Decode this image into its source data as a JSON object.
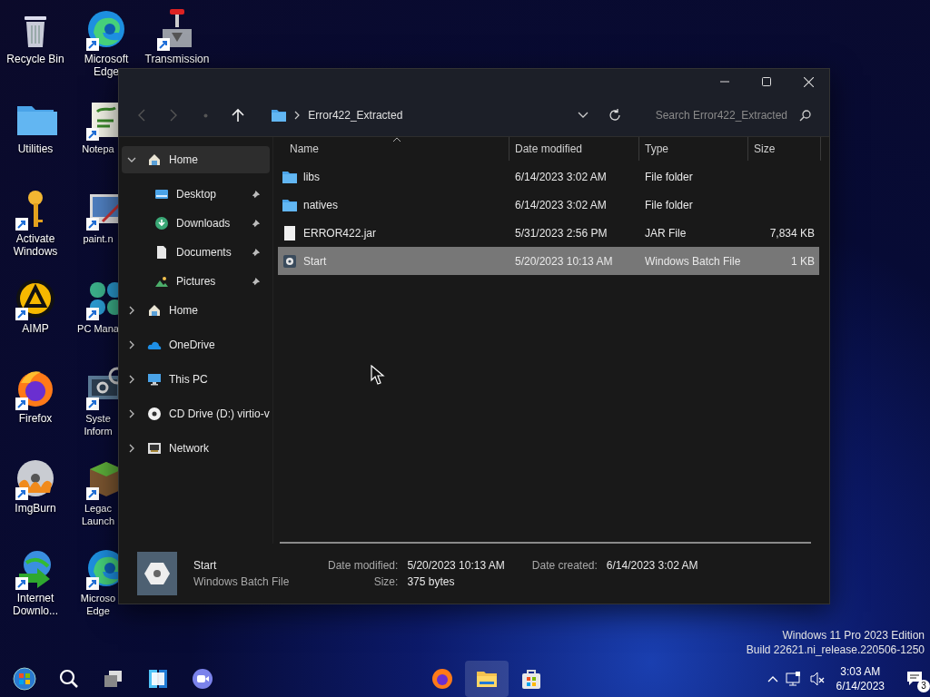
{
  "desktop_icons": [
    {
      "kind": "bin",
      "label": "Recycle Bin",
      "shortcut": false
    },
    {
      "kind": "folder",
      "label": "Utilities",
      "shortcut": false
    },
    {
      "kind": "key",
      "label": "Activate Windows",
      "shortcut": true
    },
    {
      "kind": "aimp",
      "label": "AIMP",
      "shortcut": true
    },
    {
      "kind": "firefox",
      "label": "Firefox",
      "shortcut": true
    },
    {
      "kind": "imgburn",
      "label": "ImgBurn",
      "shortcut": true
    },
    {
      "kind": "idm",
      "label": "Internet Downlo...",
      "shortcut": true
    },
    {
      "kind": "edge",
      "label": "Microsoft Edge",
      "shortcut": true
    },
    {
      "kind": "notepad",
      "label": "Notepa",
      "shortcut": true
    },
    {
      "kind": "paint",
      "label": "paint.n",
      "shortcut": true
    },
    {
      "kind": "pcmanager",
      "label": "PC Mana",
      "shortcut": true
    },
    {
      "kind": "sysinfo",
      "label": "Syste Inform",
      "shortcut": true
    },
    {
      "kind": "minecraft",
      "label": "Legac Launch",
      "shortcut": true
    },
    {
      "kind": "edge",
      "label": "Microso Edge",
      "shortcut": true
    },
    {
      "kind": "transmission",
      "label": "Transmission",
      "shortcut": true
    }
  ],
  "explorer": {
    "nav": [
      {
        "kind": "back",
        "disabled": true
      },
      {
        "kind": "forward",
        "disabled": true
      },
      {
        "kind": "recent",
        "disabled": true
      },
      {
        "kind": "up",
        "disabled": false
      }
    ],
    "path": [
      "Error422_Extracted"
    ],
    "search": {
      "placeholder": "Search Error422_Extracted"
    },
    "sidebar": {
      "items": [
        {
          "kind": "home",
          "label": "Home",
          "expanded": true,
          "selected": true,
          "children": [
            {
              "kind": "desktop",
              "label": "Desktop",
              "pinned": true,
              "selected": false
            },
            {
              "kind": "downloads",
              "label": "Downloads",
              "pinned": true,
              "selected": false
            },
            {
              "kind": "documents",
              "label": "Documents",
              "pinned": true,
              "selected": false
            },
            {
              "kind": "pictures",
              "label": "Pictures",
              "pinned": true,
              "selected": false
            }
          ]
        },
        {
          "kind": "home",
          "label": "Home",
          "expanded": false,
          "selected": false
        },
        {
          "kind": "onedrive",
          "label": "OneDrive",
          "expanded": false,
          "selected": false
        },
        {
          "kind": "pc",
          "label": "This PC",
          "expanded": false,
          "selected": false
        },
        {
          "kind": "cd",
          "label": "CD Drive (D:) virtio-v",
          "expanded": false,
          "selected": false
        },
        {
          "kind": "network",
          "label": "Network",
          "expanded": false,
          "selected": false
        }
      ]
    },
    "files": {
      "columns": [
        {
          "label": "Name",
          "sorted": true
        },
        {
          "label": "Date modified",
          "sorted": false
        },
        {
          "label": "Type",
          "sorted": false
        },
        {
          "label": "Size",
          "sorted": false
        }
      ],
      "rows": [
        {
          "kind": "folder",
          "name": "libs",
          "date": "6/14/2023 3:02 AM",
          "type": "File folder",
          "size": "",
          "selected": false
        },
        {
          "kind": "folder",
          "name": "natives",
          "date": "6/14/2023 3:02 AM",
          "type": "File folder",
          "size": "",
          "selected": false
        },
        {
          "kind": "file",
          "name": "ERROR422.jar",
          "date": "5/31/2023 2:56 PM",
          "type": "JAR File",
          "size": "7,834 KB",
          "selected": false
        },
        {
          "kind": "batch",
          "name": "Start",
          "date": "5/20/2023 10:13 AM",
          "type": "Windows Batch File",
          "size": "1 KB",
          "selected": true
        }
      ]
    },
    "details": {
      "name": "Start",
      "type": "Windows Batch File",
      "fields": [
        {
          "label": "Date modified:",
          "value": "5/20/2023 10:13 AM"
        },
        {
          "label": "Date created:",
          "value": "6/14/2023 3:02 AM"
        },
        {
          "label": "Size:",
          "value": "375 bytes"
        }
      ]
    }
  },
  "build_info": [
    "Windows 11 Pro 2023 Edition",
    "Build 22621.ni_release.220506-1250"
  ],
  "taskbar": {
    "left": [
      {
        "kind": "start"
      },
      {
        "kind": "search"
      },
      {
        "kind": "taskview"
      },
      {
        "kind": "widgets"
      },
      {
        "kind": "chat"
      }
    ],
    "apps": [
      {
        "kind": "firefox",
        "active": false
      },
      {
        "kind": "explorer",
        "active": true
      },
      {
        "kind": "store",
        "active": false
      }
    ],
    "clock": {
      "time": "3:03 AM",
      "date": "6/14/2023"
    },
    "notifications": "3"
  }
}
